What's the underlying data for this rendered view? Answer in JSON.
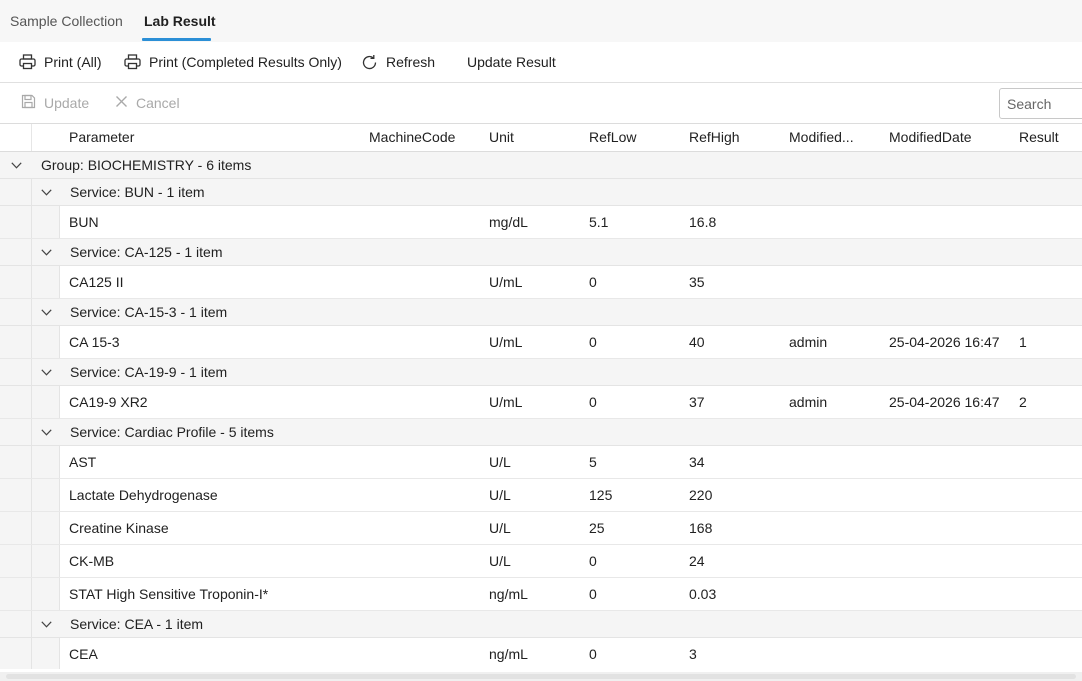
{
  "tabs": [
    {
      "label": "Sample Collection",
      "active": false
    },
    {
      "label": "Lab Result",
      "active": true
    }
  ],
  "toolbar": {
    "print_all": "Print (All)",
    "print_completed": "Print (Completed Results Only)",
    "refresh": "Refresh",
    "update_result": "Update Result"
  },
  "editbar": {
    "update": "Update",
    "cancel": "Cancel",
    "search_placeholder": "Search"
  },
  "columns": [
    "Parameter",
    "MachineCode",
    "Unit",
    "RefLow",
    "RefHigh",
    "Modified...",
    "ModifiedDate",
    "Result"
  ],
  "group": {
    "label": "Group: BIOCHEMISTRY - 6 items"
  },
  "services": [
    {
      "label": "Service: BUN - 1 item",
      "rows": [
        {
          "parameter": "BUN",
          "machine_code": "",
          "unit": "mg/dL",
          "ref_low": "5.1",
          "ref_high": "16.8",
          "modified_by": "",
          "modified_date": "",
          "result": ""
        }
      ]
    },
    {
      "label": "Service: CA-125 - 1 item",
      "rows": [
        {
          "parameter": "CA125 II",
          "machine_code": "",
          "unit": "U/mL",
          "ref_low": "0",
          "ref_high": "35",
          "modified_by": "",
          "modified_date": "",
          "result": ""
        }
      ]
    },
    {
      "label": "Service: CA-15-3 - 1 item",
      "rows": [
        {
          "parameter": "CA 15-3",
          "machine_code": "",
          "unit": "U/mL",
          "ref_low": "0",
          "ref_high": "40",
          "modified_by": "admin",
          "modified_date": "25-04-2026 16:47",
          "result": "1"
        }
      ]
    },
    {
      "label": "Service: CA-19-9 - 1 item",
      "rows": [
        {
          "parameter": "CA19-9 XR2",
          "machine_code": "",
          "unit": "U/mL",
          "ref_low": "0",
          "ref_high": "37",
          "modified_by": "admin",
          "modified_date": "25-04-2026 16:47",
          "result": "2"
        }
      ]
    },
    {
      "label": "Service: Cardiac Profile - 5 items",
      "rows": [
        {
          "parameter": "AST",
          "machine_code": "",
          "unit": "U/L",
          "ref_low": "5",
          "ref_high": "34",
          "modified_by": "",
          "modified_date": "",
          "result": ""
        },
        {
          "parameter": "Lactate Dehydrogenase",
          "machine_code": "",
          "unit": "U/L",
          "ref_low": "125",
          "ref_high": "220",
          "modified_by": "",
          "modified_date": "",
          "result": ""
        },
        {
          "parameter": "Creatine Kinase",
          "machine_code": "",
          "unit": "U/L",
          "ref_low": "25",
          "ref_high": "168",
          "modified_by": "",
          "modified_date": "",
          "result": ""
        },
        {
          "parameter": "CK-MB",
          "machine_code": "",
          "unit": "U/L",
          "ref_low": "0",
          "ref_high": "24",
          "modified_by": "",
          "modified_date": "",
          "result": ""
        },
        {
          "parameter": "STAT High Sensitive Troponin-I*",
          "machine_code": "",
          "unit": "ng/mL",
          "ref_low": "0",
          "ref_high": "0.03",
          "modified_by": "",
          "modified_date": "",
          "result": ""
        }
      ]
    },
    {
      "label": "Service: CEA - 1 item",
      "rows": [
        {
          "parameter": "CEA",
          "machine_code": "",
          "unit": "ng/mL",
          "ref_low": "0",
          "ref_high": "3",
          "modified_by": "",
          "modified_date": "",
          "result": ""
        }
      ]
    }
  ],
  "icons": {
    "print": "printer-icon",
    "refresh": "refresh-icon",
    "save": "save-icon",
    "cancel": "close-icon",
    "expand": "chevron-down-icon"
  },
  "colors": {
    "accent": "#2b8fd6"
  }
}
